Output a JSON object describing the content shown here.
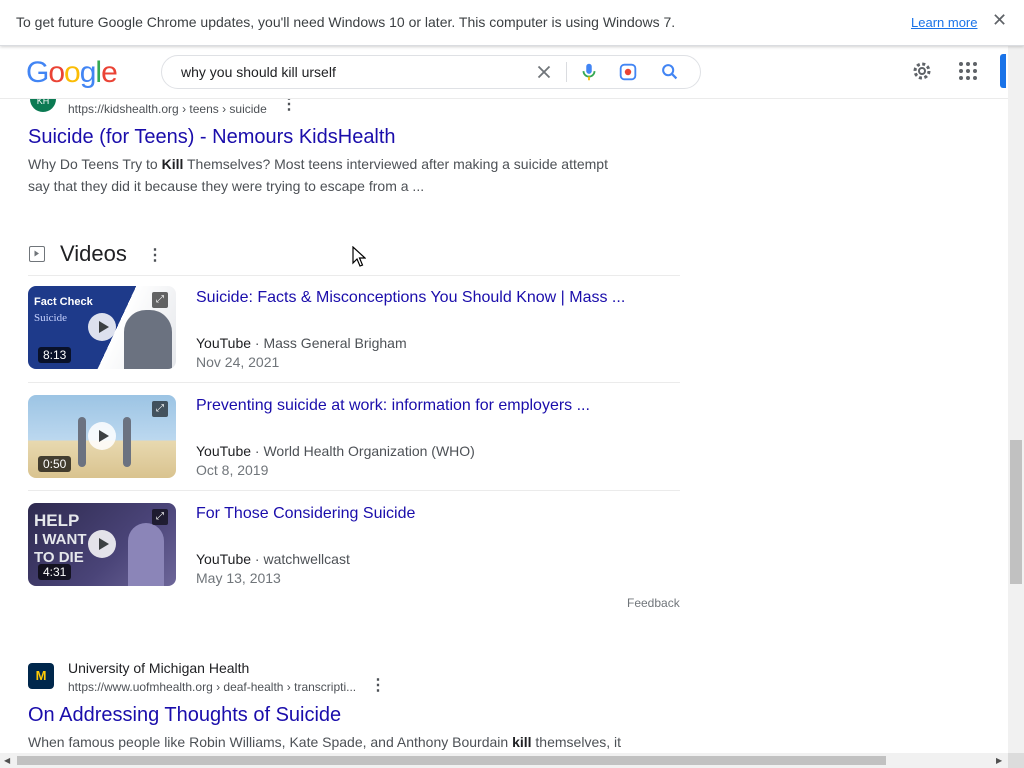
{
  "infobar": {
    "message": "To get future Google Chrome updates, you'll need Windows 10 or later. This computer is using Windows 7.",
    "learn_more": "Learn more",
    "close": "✕"
  },
  "header": {
    "logo_letters": [
      "G",
      "o",
      "o",
      "g",
      "l",
      "e"
    ],
    "logo_colors": [
      "#4285f4",
      "#ea4335",
      "#fbbc05",
      "#4285f4",
      "#34a853",
      "#ea4335"
    ],
    "query": "why you should kill urself"
  },
  "results": [
    {
      "favicon_text": "KH",
      "cite": "https://kidshealth.org › teens › suicide",
      "title": "Suicide (for Teens) - Nemours KidsHealth",
      "snippet_pre": "Why Do Teens Try to ",
      "snippet_bold": "Kill",
      "snippet_post": " Themselves? Most teens interviewed after making a suicide attempt say that they did it because they were trying to escape from a ..."
    },
    {
      "favicon_text": "M",
      "site_name": "University of Michigan Health",
      "cite": "https://www.uofmhealth.org › deaf-health › transcripti...",
      "title": "On Addressing Thoughts of Suicide",
      "snippet_pre": "When famous people like Robin Williams, Kate Spade, and Anthony Bourdain ",
      "snippet_bold": "kill",
      "snippet_post": " themselves, it"
    }
  ],
  "videos": {
    "heading": "Videos",
    "items": [
      {
        "title": "Suicide: Facts & Misconceptions You Should Know | Mass ...",
        "platform": "YouTube",
        "channel": "Mass General Brigham",
        "date": "Nov 24, 2021",
        "duration": "8:13",
        "thumb_text_1": "Fact Check",
        "thumb_text_2": "Suicide"
      },
      {
        "title": "Preventing suicide at work: information for employers ...",
        "platform": "YouTube",
        "channel": "World Health Organization (WHO)",
        "date": "Oct 8, 2019",
        "duration": "0:50"
      },
      {
        "title": "For Those Considering Suicide",
        "platform": "YouTube",
        "channel": "watchwellcast",
        "date": "May 13, 2013",
        "duration": "4:31",
        "thumb_text_1": "HELP",
        "thumb_text_2": "I WANT",
        "thumb_text_3": "TO DIE"
      }
    ],
    "feedback": "Feedback"
  },
  "separator": " · ",
  "colors": {
    "link": "#1a0dab",
    "accent": "#1a73e8"
  }
}
